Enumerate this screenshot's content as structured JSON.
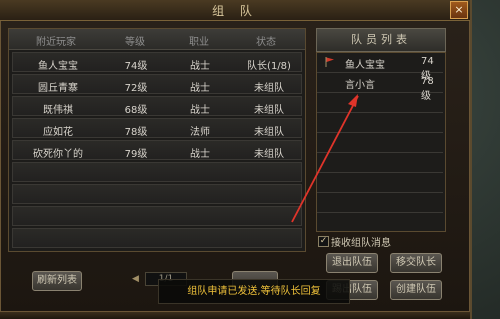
{
  "window": {
    "title": "组 队",
    "close_glyph": "×"
  },
  "players_table": {
    "headers": [
      "附近玩家",
      "等级",
      "职业",
      "状态"
    ],
    "rows": [
      [
        "鱼人宝宝",
        "74级",
        "战士",
        "队长(1/8)"
      ],
      [
        "圆丘青寨",
        "72级",
        "战士",
        "未组队"
      ],
      [
        "既伟祺",
        "68级",
        "战士",
        "未组队"
      ],
      [
        "应如花",
        "78级",
        "法师",
        "未组队"
      ],
      [
        "砍死你丫的",
        "79级",
        "战士",
        "未组队"
      ]
    ]
  },
  "members": {
    "title": "队员列表",
    "items": [
      {
        "name": "鱼人宝宝",
        "level": "74级",
        "leader": true
      },
      {
        "name": "言小言",
        "level": "78级",
        "leader": false
      }
    ]
  },
  "options": {
    "accept_messages_label": "接收组队消息",
    "accept_messages_checked": true,
    "check_glyph": "✓"
  },
  "buttons": {
    "refresh_list": "刷新列表",
    "leave_team": "退出队伍",
    "transfer_leader": "移交队长",
    "kick": "踢出队伍",
    "create_team": "创建队伍"
  },
  "pager": {
    "prev_glyph": "◀",
    "page": "1/1"
  },
  "toast": {
    "message": "组队申请已发送,等待队长回复"
  },
  "colors": {
    "toast_text": "#f0c23a",
    "arrow": "#e0342a",
    "leader_flag": "#d23a2a"
  },
  "icons": {
    "leader_flag": "flag-icon",
    "close": "close-icon",
    "prev_page": "triangle-left-icon",
    "annotation_arrow": "red-arrow-annotation"
  }
}
